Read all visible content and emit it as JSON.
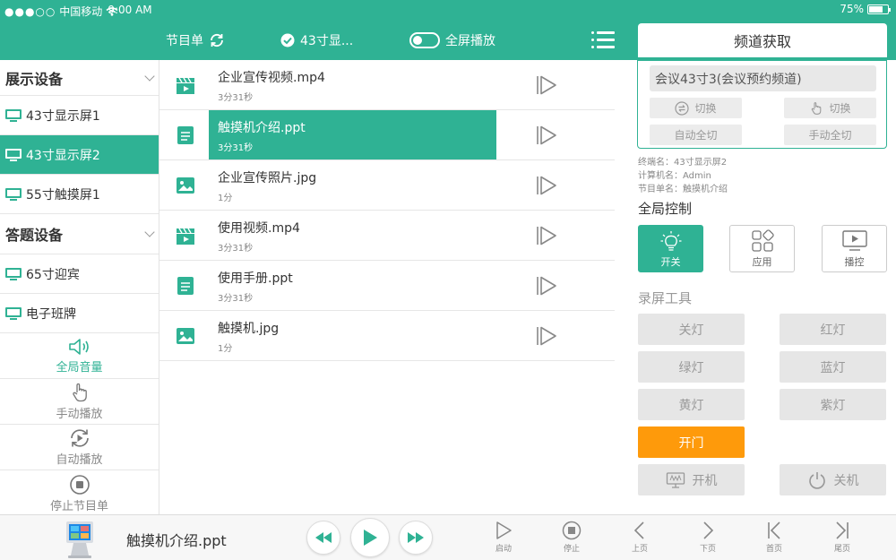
{
  "status_bar": {
    "signal": "●●●○○",
    "carrier": "中国移动",
    "time": "9:00 AM",
    "battery": "75%",
    "battery_level": 0.75
  },
  "header": {
    "program_label": "节目单",
    "display_label": "43寸显...",
    "fullscreen_label": "全屏播放",
    "fullscreen_on": false,
    "channel_fetch_tab": "频道获取"
  },
  "sidebar": {
    "groups": [
      {
        "title": "展示设备",
        "devices": [
          {
            "label": "43寸显示屏1",
            "active": false
          },
          {
            "label": "43寸显示屏2",
            "active": true
          },
          {
            "label": "55寸触摸屏1",
            "active": false
          }
        ]
      },
      {
        "title": "答题设备",
        "devices": [
          {
            "label": "65寸迎宾",
            "active": false
          },
          {
            "label": "电子班牌",
            "active": false
          }
        ]
      }
    ],
    "actions": [
      {
        "label": "全局音量",
        "icon": "speaker-icon"
      },
      {
        "label": "手动播放",
        "icon": "hand-pointer-icon"
      },
      {
        "label": "自动播放",
        "icon": "auto-play-icon"
      },
      {
        "label": "停止节目单",
        "icon": "stop-icon"
      }
    ]
  },
  "files": [
    {
      "name": "企业宣传视频.mp4",
      "duration": "3分31秒",
      "type": "video",
      "icon": "video-clapper-icon"
    },
    {
      "name": "触摸机介绍.ppt",
      "duration": "3分31秒",
      "type": "document",
      "icon": "document-icon",
      "selected": true
    },
    {
      "name": "企业宣传照片.jpg",
      "duration": "1分",
      "type": "image",
      "icon": "image-icon"
    },
    {
      "name": "使用视频.mp4",
      "duration": "3分31秒",
      "type": "video",
      "icon": "video-clapper-icon"
    },
    {
      "name": "使用手册.ppt",
      "duration": "3分31秒",
      "type": "document",
      "icon": "document-icon"
    },
    {
      "name": "触摸机.jpg",
      "duration": "1分",
      "type": "image",
      "icon": "image-icon"
    }
  ],
  "channel_panel": {
    "channel_select": "会议43寸3(会议预约频道)",
    "switch_label": "切换",
    "switch_manual_label": "切换",
    "auto_all_label": "自动全切",
    "manual_all_label": "手动全切",
    "terminal_name": "终端名：43寸显示屏2",
    "computer_name": "计算机名：Admin",
    "program_name": "节目单名：触摸机介绍"
  },
  "global_control": {
    "title": "全局控制",
    "buttons": [
      {
        "label": "开关",
        "icon": "bulb-icon",
        "active": true
      },
      {
        "label": "应用",
        "icon": "apps-icon",
        "active": false
      },
      {
        "label": "播控",
        "icon": "monitor-play-icon",
        "active": false
      }
    ]
  },
  "record_tools": {
    "title": "录屏工具",
    "buttons": [
      "关灯",
      "红灯",
      "绿灯",
      "蓝灯",
      "黄灯",
      "紫灯",
      "开门"
    ],
    "power_on_label": "开机",
    "power_off_label": "关机"
  },
  "bottom_bar": {
    "now_playing": "触摸机介绍.ppt",
    "controls": [
      {
        "label": "启动",
        "icon": "start-icon"
      },
      {
        "label": "停止",
        "icon": "stop-icon"
      },
      {
        "label": "上页",
        "icon": "chevron-left-icon"
      },
      {
        "label": "下页",
        "icon": "chevron-right-icon"
      },
      {
        "label": "首页",
        "icon": "first-page-icon"
      },
      {
        "label": "尾页",
        "icon": "last-page-icon"
      }
    ]
  },
  "colors": {
    "accent": "#2fb294",
    "orange": "#fe9a0b",
    "button_grey": "#e6e6e6"
  }
}
